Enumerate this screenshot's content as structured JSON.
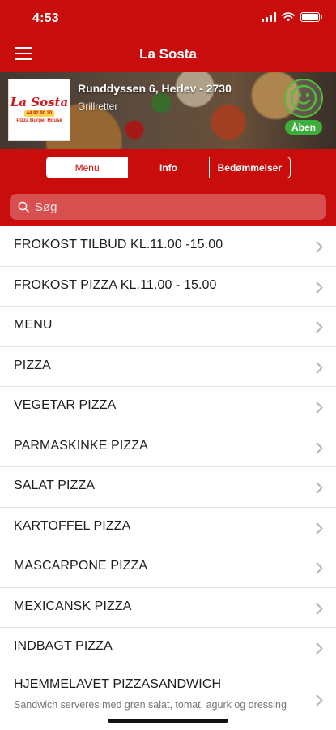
{
  "status_bar": {
    "time": "4:53"
  },
  "nav": {
    "title": "La Sosta"
  },
  "banner": {
    "address": "Runddyssen 6, Herlev - 2730",
    "category": "Grillretter",
    "open_status": "Åben",
    "logo": {
      "name": "La Sosta",
      "phone": "44 92 90 20",
      "subtitle": "Pizza Burger House"
    }
  },
  "tabs": [
    {
      "label": "Menu",
      "active": true
    },
    {
      "label": "Info",
      "active": false
    },
    {
      "label": "Bedømmelser",
      "active": false
    }
  ],
  "search": {
    "placeholder": "Søg"
  },
  "menu_items": [
    {
      "title": "FROKOST TILBUD KL.11.00 -15.00"
    },
    {
      "title": "FROKOST PIZZA KL.11.00 - 15.00"
    },
    {
      "title": "MENU"
    },
    {
      "title": "PIZZA"
    },
    {
      "title": "VEGETAR PIZZA"
    },
    {
      "title": "PARMASKINKE PIZZA"
    },
    {
      "title": "SALAT PIZZA"
    },
    {
      "title": "KARTOFFEL PIZZA"
    },
    {
      "title": "MASCARPONE PIZZA"
    },
    {
      "title": "MEXICANSK PIZZA"
    },
    {
      "title": "INDBAGT PIZZA"
    },
    {
      "title": "HJEMMELAVET PIZZASANDWICH",
      "subtitle": "Sandwich serveres med grøn salat, tomat, agurk og dressing"
    }
  ],
  "colors": {
    "brand_red": "#c90c0c",
    "open_green": "#3cae3c"
  }
}
